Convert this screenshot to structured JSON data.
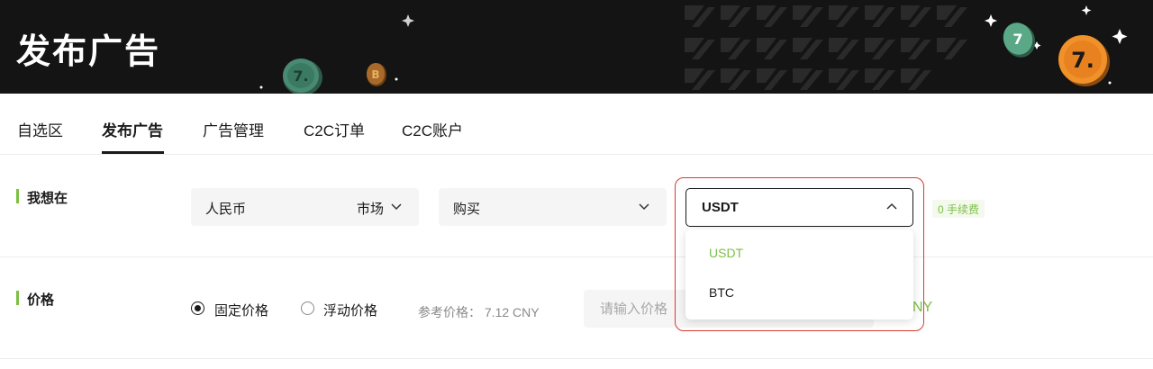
{
  "banner": {
    "title": "发布广告"
  },
  "tabs": [
    {
      "label": "自选区"
    },
    {
      "label": "发布广告"
    },
    {
      "label": "广告管理"
    },
    {
      "label": "C2C订单"
    },
    {
      "label": "C2C账户"
    }
  ],
  "active_tab": "发布广告",
  "want_section": {
    "label": "我想在",
    "currency_select": {
      "value": "人民币",
      "mode": "市场"
    },
    "action_select": {
      "value": "购买"
    },
    "coin_select": {
      "value": "USDT",
      "options": [
        "USDT",
        "BTC"
      ],
      "selected": "USDT"
    },
    "fee_badge": "0 手续费"
  },
  "price_section": {
    "label": "价格",
    "fixed_label": "固定价格",
    "floating_label": "浮动价格",
    "selected": "fixed",
    "ref_price": "参考价格：  7.12 CNY",
    "input_placeholder": "请输入价格",
    "suffix": "NY"
  },
  "colors": {
    "accent": "#7bc043",
    "highlight": "#d93b2b",
    "banner_bg": "#141414"
  },
  "icons": {
    "chevron": "chevron-down-icon",
    "chevron_up": "chevron-up-icon"
  }
}
